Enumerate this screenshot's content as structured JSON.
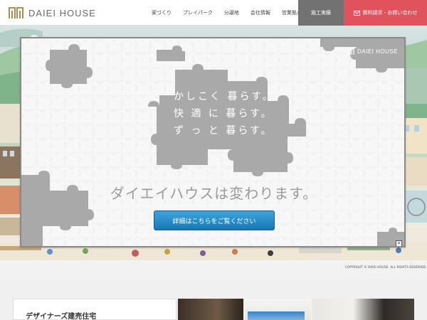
{
  "header": {
    "logo_text": "DAIEI HOUSE",
    "nav": [
      "家づくり",
      "プレイパーク",
      "分譲地",
      "会社情報",
      "営業拠点"
    ],
    "works_label": "施工実績",
    "contact_label": "資料請求・お問い合わせ"
  },
  "modal": {
    "brand": "DAIEI HOUSE",
    "slogan": [
      "かしこく 暮らす。",
      "快 適 に 暮らす。",
      "ず っ と 暮らす。"
    ],
    "headline": "ダイエイハウスは変わります。",
    "button_label": "詳細はこちらをご覧ください",
    "close_label": "×"
  },
  "copyright": "COPYRIGHT © DAIEI HOUSE. ALL RIGHTS RESERVED.",
  "lower": {
    "card_title": "デザイナーズ建売住宅"
  },
  "colors": {
    "accent_red": "#e0535d",
    "gray_button": "#727272",
    "blue_button": "#1777b7",
    "puzzle_gray": "#a9a9a9"
  }
}
